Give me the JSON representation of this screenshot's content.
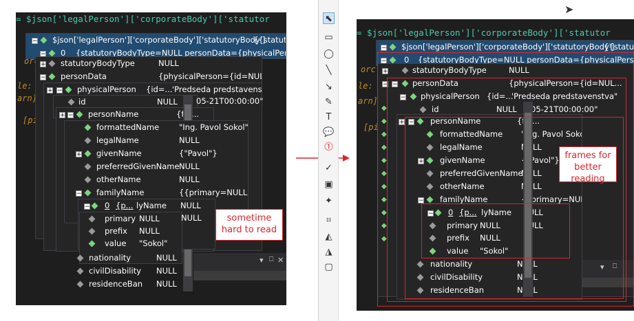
{
  "code_expression": "= $json['legalPerson']['corporateBody']['statutor",
  "background_fragments": [
    "orc",
    "le:",
    "arn]",
    "[pi"
  ],
  "tree": {
    "header_key": "$json['legalPerson']['corporateBody']['statutoryBody']",
    "header_val": "{{statuto",
    "item0_index": "0",
    "item0_val": "{statutoryBodyType=NULL personData={physicalPerson={",
    "statutory_body_type": {
      "name": "statutoryBodyType",
      "value": "NULL"
    },
    "person_data": {
      "name": "personData",
      "value": "{physicalPerson={id=NUL..."
    },
    "physical_person": {
      "name": "physicalPerson",
      "value": "{id=...",
      "value2": "'Predseda predstavenstva\"",
      "value2_right": "'Predseda predstavenstva\""
    },
    "id": {
      "name": "id",
      "value": "NULL",
      "extra": "05-21T00:00:00\""
    },
    "person_name": {
      "name": "personName",
      "value": "{for..."
    },
    "formatted_name": {
      "name": "formattedName",
      "value": "\"Ing. Pavol Sokol\""
    },
    "legal_name": {
      "name": "legalName",
      "value": "NULL"
    },
    "given_name": {
      "name": "givenName",
      "value": "{\"Pavol\"}"
    },
    "preferred_given_name": {
      "name": "preferredGivenName",
      "value": "NULL"
    },
    "other_name": {
      "name": "otherName",
      "value": "NULL"
    },
    "family_name": {
      "name": "familyName",
      "value": "{{primary=NULL ..."
    },
    "family_item": {
      "index": "0",
      "type": "{p...",
      "name_tail": "lyName",
      "value": "NULL"
    },
    "primary": {
      "name": "primary",
      "value": "NULL"
    },
    "prefix": {
      "name": "prefix",
      "value": "NULL"
    },
    "value_row": {
      "name": "value",
      "value": "\"Sokol\""
    },
    "nationality": {
      "name": "nationality",
      "value": "NULL"
    },
    "civil_disability": {
      "name": "civilDisability",
      "value": "NULL"
    },
    "residence_ban": {
      "name": "residenceBan",
      "value": "NULL"
    },
    "stray_value": "NULL",
    "stray_l": "L"
  },
  "annotations": {
    "left_note": "sometime hard to read",
    "right_note": "frames for better reading"
  },
  "panel_controls": {
    "dropdown": "▾",
    "pin": "⎕",
    "close": "✕"
  },
  "colors": {
    "annotation_red": "#d8262e",
    "ide_background": "#1e1e1e",
    "tooltip_background": "#252526",
    "selection": "#214b70",
    "arrow": "#d8262e"
  }
}
